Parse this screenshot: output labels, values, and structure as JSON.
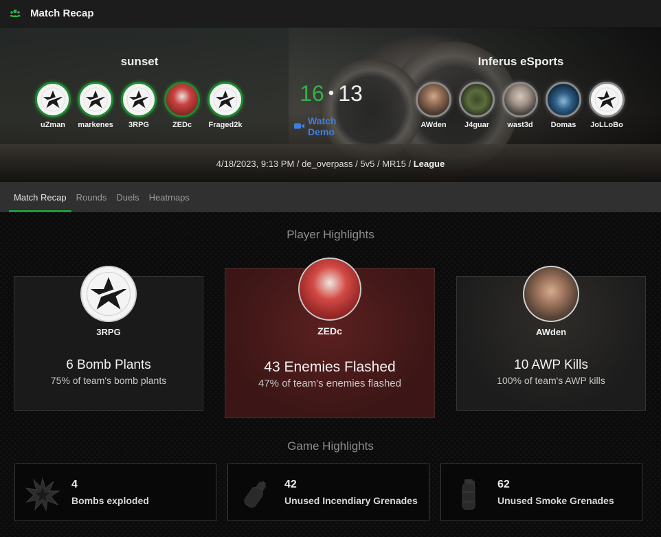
{
  "window": {
    "title": "Match Recap",
    "icon": "users-icon"
  },
  "match": {
    "team_left": {
      "name": "sunset",
      "players": [
        "uZman",
        "markenes",
        "3RPG",
        "ZEDc",
        "Fraged2k"
      ]
    },
    "team_right": {
      "name": "Inferus eSports",
      "players": [
        "AWden",
        "J4guar",
        "wast3d",
        "Domas",
        "JoLLoBo"
      ]
    },
    "score_left": "16",
    "score_sep": "•",
    "score_right": "13",
    "watch_demo_label": "Watch Demo",
    "meta_text": "4/18/2023, 9:13 PM / de_overpass / 5v5 / MR15 / ",
    "meta_type": "League"
  },
  "tabs": [
    {
      "label": "Match Recap",
      "active": true
    },
    {
      "label": "Rounds",
      "active": false
    },
    {
      "label": "Duels",
      "active": false
    },
    {
      "label": "Heatmaps",
      "active": false
    }
  ],
  "player_highlights": {
    "title": "Player Highlights",
    "cards": [
      {
        "player": "3RPG",
        "stat": "6 Bomb Plants",
        "detail": "75% of team's bomb plants"
      },
      {
        "player": "ZEDc",
        "stat": "43 Enemies Flashed",
        "detail": "47% of team's enemies flashed"
      },
      {
        "player": "AWden",
        "stat": "10 AWP Kills",
        "detail": "100% of team's AWP kills"
      }
    ]
  },
  "game_highlights": {
    "title": "Game Highlights",
    "cards": [
      {
        "value": "4",
        "label": "Bombs exploded",
        "icon": "explosion-icon"
      },
      {
        "value": "42",
        "label": "Unused Incendiary Grenades",
        "icon": "incendiary-grenade-icon"
      },
      {
        "value": "62",
        "label": "Unused Smoke Grenades",
        "icon": "smoke-grenade-icon"
      }
    ]
  },
  "colors": {
    "accent_green": "#1f9a3a",
    "score_green": "#31b347",
    "link_blue": "#3f7fe0"
  }
}
